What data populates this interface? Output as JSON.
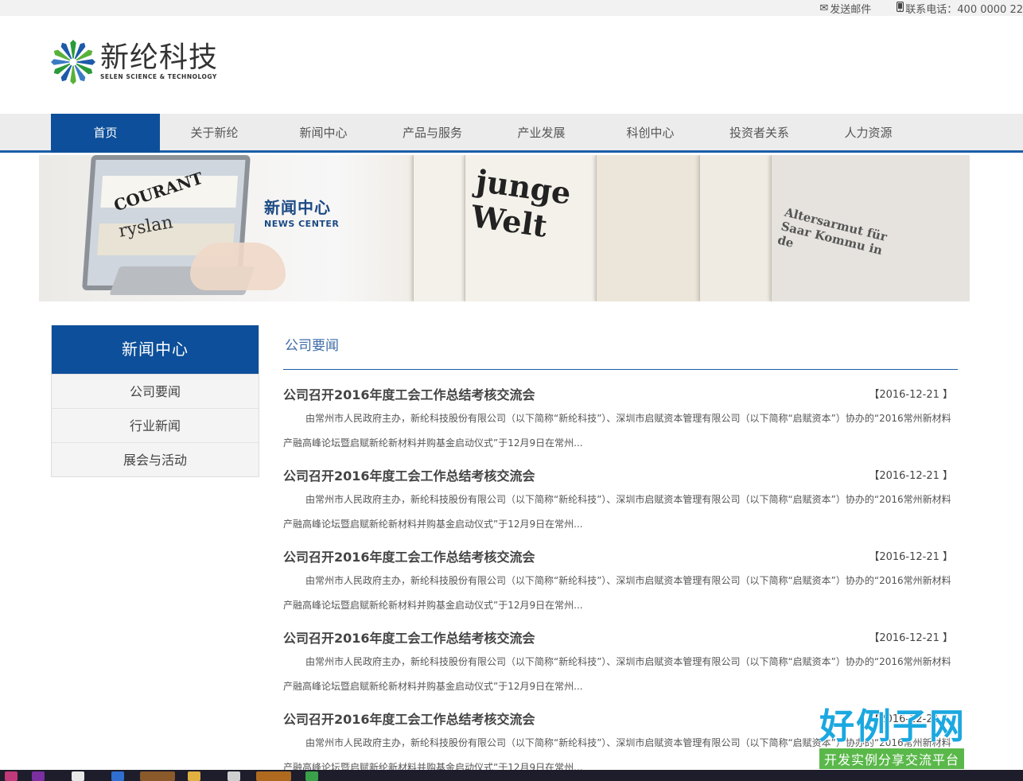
{
  "topbar": {
    "email_label": "发送邮件",
    "phone_label": "联系电话：400 0000 22"
  },
  "logo": {
    "name_cn": "新纶科技",
    "name_en": "SELEN SCIENCE & TECHNOLOGY"
  },
  "nav": {
    "items": [
      "首页",
      "关于新纶",
      "新闻中心",
      "产品与服务",
      "产业发展",
      "科创中心",
      "投资者关系",
      "人力资源"
    ],
    "active_index": 0
  },
  "banner": {
    "title_cn": "新闻中心",
    "title_en": "NEWS CENTER",
    "newspaper_texts": [
      "COURANT",
      "ryslan",
      "junge Welt",
      "Altersarmut für Saar Kommu in de"
    ]
  },
  "sidebar": {
    "title": "新闻中心",
    "items": [
      "公司要闻",
      "行业新闻",
      "展会与活动"
    ]
  },
  "content": {
    "section_title": "公司要闻",
    "news": [
      {
        "title": "公司召开2016年度工会工作总结考核交流会",
        "date": "【2016-12-21 】",
        "summary": "由常州市人民政府主办，新纶科技股份有限公司（以下简称“新纶科技”）、深圳市启赋资本管理有限公司（以下简称“启赋资本”）协办的“2016常州新材料产融高峰论坛暨启赋新纶新材料并购基金启动仪式”于12月9日在常州..."
      },
      {
        "title": "公司召开2016年度工会工作总结考核交流会",
        "date": "【2016-12-21 】",
        "summary": "由常州市人民政府主办，新纶科技股份有限公司（以下简称“新纶科技”）、深圳市启赋资本管理有限公司（以下简称“启赋资本”）协办的“2016常州新材料产融高峰论坛暨启赋新纶新材料并购基金启动仪式”于12月9日在常州..."
      },
      {
        "title": "公司召开2016年度工会工作总结考核交流会",
        "date": "【2016-12-21 】",
        "summary": "由常州市人民政府主办，新纶科技股份有限公司（以下简称“新纶科技”）、深圳市启赋资本管理有限公司（以下简称“启赋资本”）协办的“2016常州新材料产融高峰论坛暨启赋新纶新材料并购基金启动仪式”于12月9日在常州..."
      },
      {
        "title": "公司召开2016年度工会工作总结考核交流会",
        "date": "【2016-12-21 】",
        "summary": "由常州市人民政府主办，新纶科技股份有限公司（以下简称“新纶科技”）、深圳市启赋资本管理有限公司（以下简称“启赋资本”）协办的“2016常州新材料产融高峰论坛暨启赋新纶新材料并购基金启动仪式”于12月9日在常州..."
      },
      {
        "title": "公司召开2016年度工会工作总结考核交流会",
        "date": "【2016-12-21 】",
        "summary": "由常州市人民政府主办，新纶科技股份有限公司（以下简称“新纶科技”）、深圳市启赋资本管理有限公司（以下简称“启赋资本”）协办的“2016常州新材料产融高峰论坛暨启赋新纶新材料并购基金启动仪式”于12月9日在常州..."
      }
    ]
  },
  "badge": {
    "main": "好例子网",
    "sub": "开发实例分享交流平台"
  },
  "colors": {
    "brand_blue": "#0d4f9a",
    "nav_bg": "#ececec",
    "accent_line": "#1a5ea8"
  }
}
